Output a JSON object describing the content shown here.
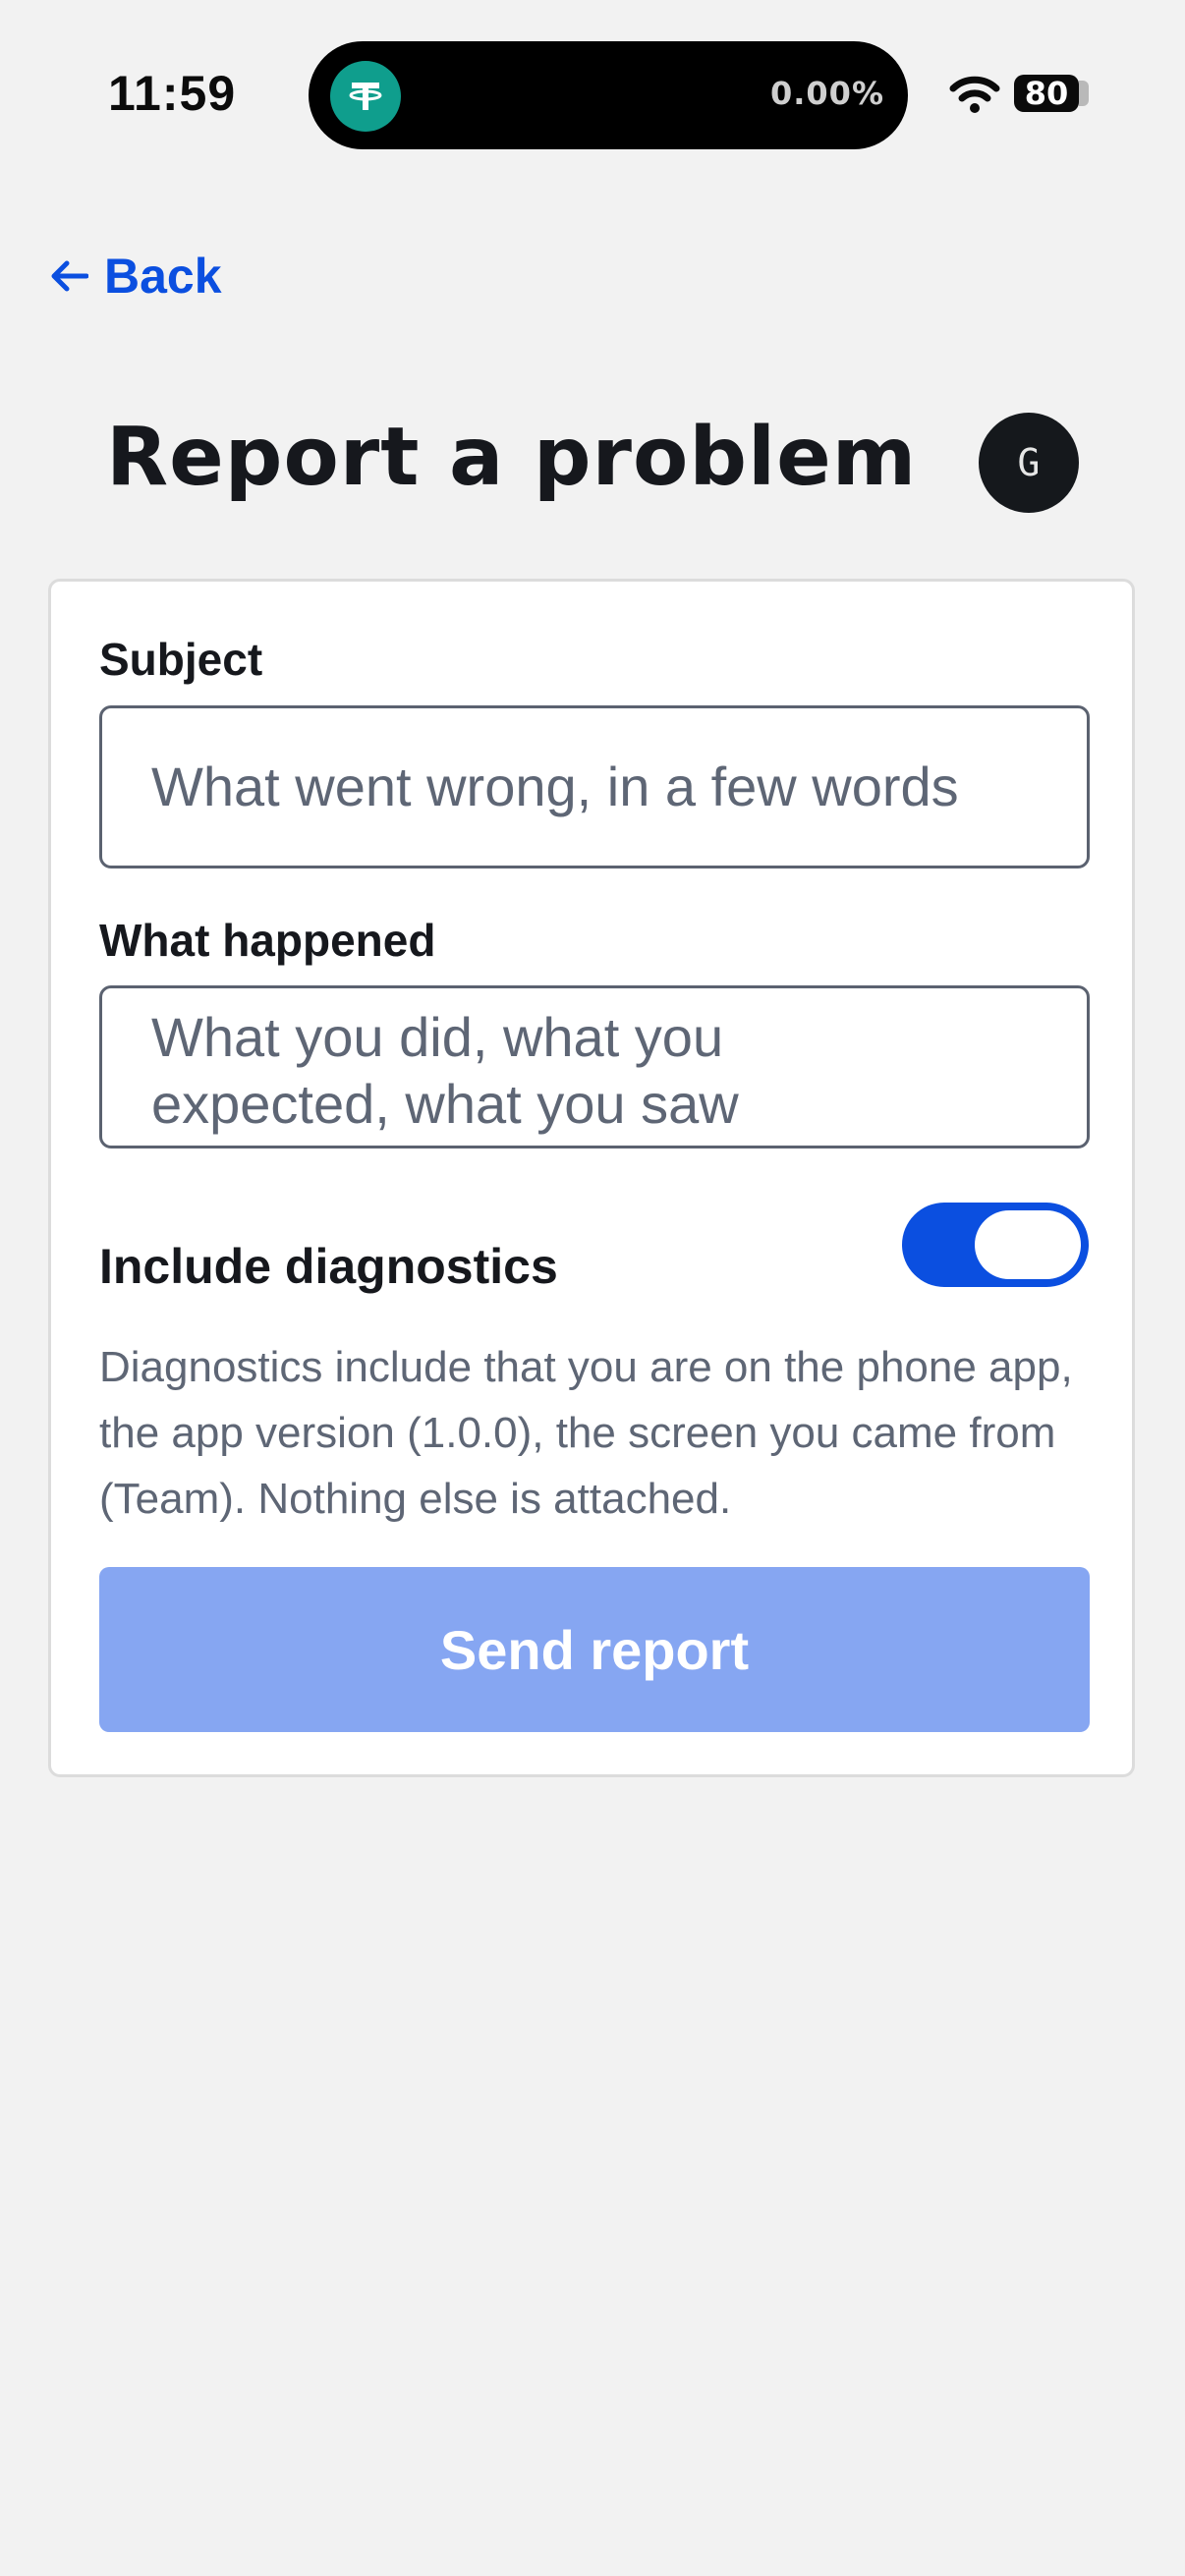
{
  "status_bar": {
    "time": "11:59",
    "ticker_percent": "0.00%",
    "battery": "80"
  },
  "nav": {
    "back_label": "Back"
  },
  "header": {
    "title": "Report a problem",
    "avatar_initial": "G"
  },
  "form": {
    "subject": {
      "label": "Subject",
      "value": "",
      "placeholder": "What went wrong, in a few words"
    },
    "details": {
      "label": "What happened",
      "value": "",
      "placeholder": "What you did, what you\nexpected, what you saw"
    },
    "diagnostics": {
      "label": "Include diagnostics",
      "enabled": true,
      "description": "Diagnostics include that you are on the phone app, the app version (1.0.0), the screen you came from (Team). Nothing else is attached."
    },
    "submit_label": "Send report"
  },
  "colors": {
    "accent": "#0b4fe0",
    "submit_disabled": "#86a6f2",
    "background": "#f2f2f2",
    "tether_badge": "#0f9e8d"
  },
  "icons": [
    "tether-icon",
    "wifi-icon",
    "battery-icon",
    "arrow-left-icon"
  ]
}
